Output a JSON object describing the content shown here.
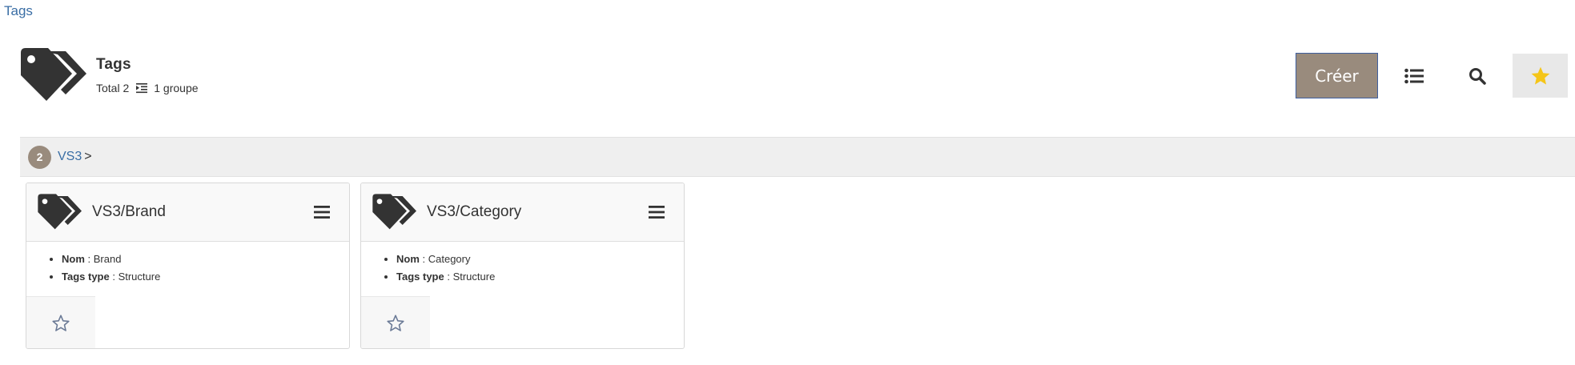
{
  "breadcrumb": {
    "label": "Tags"
  },
  "header": {
    "title": "Tags",
    "total_label": "Total 2",
    "groups_label": "1 groupe",
    "icon": "tag-pair-icon"
  },
  "toolbar": {
    "create_label": "Créer",
    "list_icon": "list-icon",
    "search_icon": "search-icon",
    "favorite_icon": "star-filled-icon"
  },
  "group": {
    "count": "2",
    "name": "VS3",
    "arrow": ">"
  },
  "cards": [
    {
      "title": "VS3/Brand",
      "fields": [
        {
          "key": "Nom",
          "sep": " : ",
          "value": "Brand"
        },
        {
          "key": "Tags type",
          "sep": " : ",
          "value": "Structure"
        }
      ]
    },
    {
      "title": "VS3/Category",
      "fields": [
        {
          "key": "Nom",
          "sep": " : ",
          "value": "Category"
        },
        {
          "key": "Tags type",
          "sep": " : ",
          "value": "Structure"
        }
      ]
    }
  ],
  "colors": {
    "accent": "#998b7d",
    "link": "#3a6ea5",
    "star": "#f5c518",
    "icon_dark": "#333333"
  }
}
